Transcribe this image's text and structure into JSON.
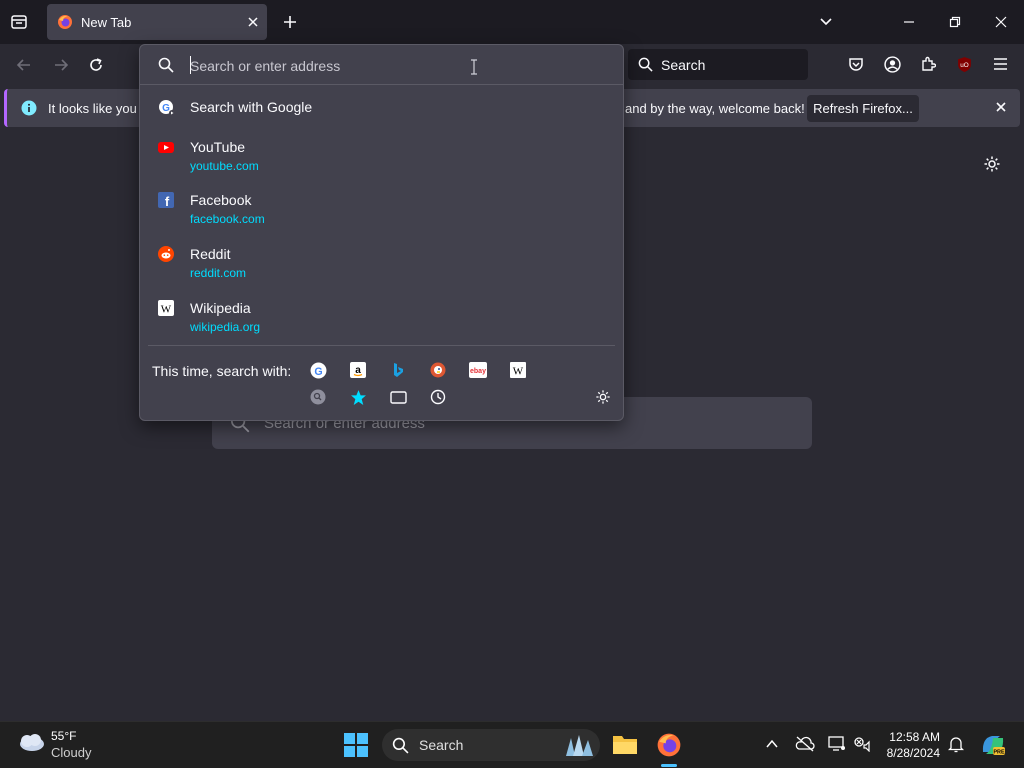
{
  "tab": {
    "title": "New Tab"
  },
  "toolbar": {
    "search_label": "Search"
  },
  "notification": {
    "message_start": "It looks like you ha",
    "message_end": "and by the way, welcome back!",
    "refresh_label": "Refresh Firefox..."
  },
  "urlbar": {
    "placeholder": "Search or enter address",
    "search_with_google": "Search with Google",
    "results": [
      {
        "title": "YouTube",
        "url": "youtube.com",
        "icon": "youtube-icon"
      },
      {
        "title": "Facebook",
        "url": "facebook.com",
        "icon": "facebook-icon"
      },
      {
        "title": "Reddit",
        "url": "reddit.com",
        "icon": "reddit-icon"
      },
      {
        "title": "Wikipedia",
        "url": "wikipedia.org",
        "icon": "wikipedia-icon"
      }
    ],
    "oneoff_label": "This time, search with:",
    "engines": [
      "google",
      "amazon",
      "bing",
      "duckduckgo",
      "ebay",
      "wikipedia"
    ],
    "modes": [
      "search-icon",
      "bookmarks-icon",
      "tabs-icon",
      "history-icon"
    ]
  },
  "ntp": {
    "search_placeholder": "Search or enter address"
  },
  "taskbar": {
    "temperature": "55°F",
    "condition": "Cloudy",
    "search_label": "Search",
    "time": "12:58 AM",
    "date": "8/28/2024"
  },
  "colors": {
    "accent": "#00ddff",
    "notification_border": "#b467ff",
    "background": "#2b2a33",
    "panel": "#42414d"
  }
}
